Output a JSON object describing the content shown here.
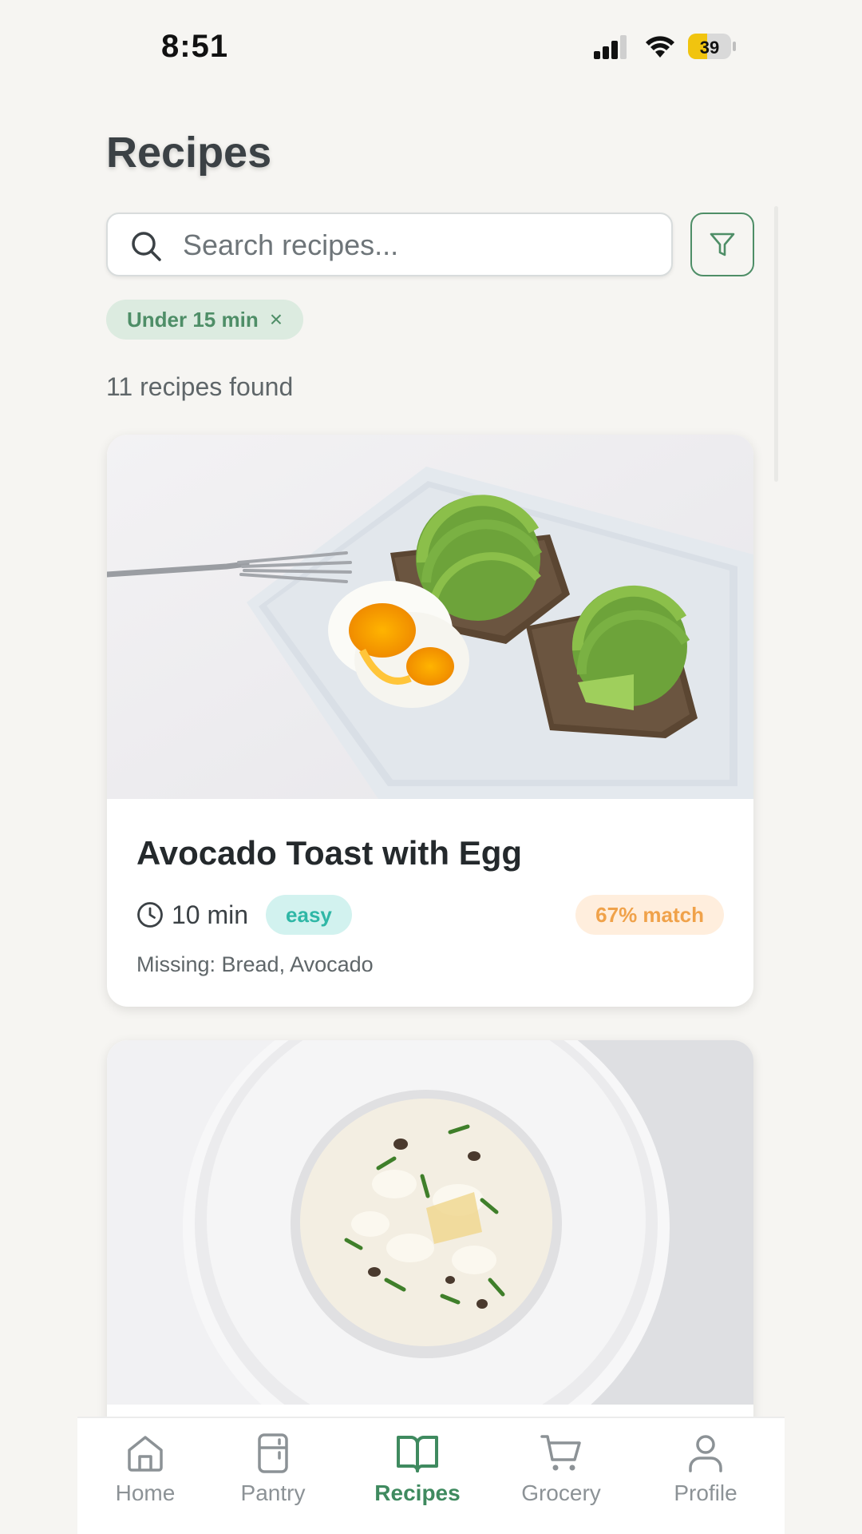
{
  "status_bar": {
    "time": "8:51",
    "battery": "39"
  },
  "header": {
    "title": "Recipes"
  },
  "search": {
    "placeholder": "Search recipes..."
  },
  "filter_chip": {
    "label": "Under 15 min",
    "remove": "×"
  },
  "results": {
    "count_text": "11 recipes found"
  },
  "recipes": [
    {
      "title": "Avocado Toast with Egg",
      "time": "10 min",
      "difficulty": "easy",
      "match": "67% match",
      "missing": "Missing: Bread, Avocado"
    },
    {
      "image": "risotto-dish"
    }
  ],
  "tabs": [
    {
      "label": "Home",
      "icon": "home-icon",
      "active": false
    },
    {
      "label": "Pantry",
      "icon": "pantry-icon",
      "active": false
    },
    {
      "label": "Recipes",
      "icon": "book-icon",
      "active": true
    },
    {
      "label": "Grocery",
      "icon": "cart-icon",
      "active": false
    },
    {
      "label": "Profile",
      "icon": "user-icon",
      "active": false
    }
  ],
  "colors": {
    "accent": "#4e8e67",
    "easy": "#2fb7a6",
    "match": "#f0a24a",
    "background": "#f6f5f2"
  }
}
